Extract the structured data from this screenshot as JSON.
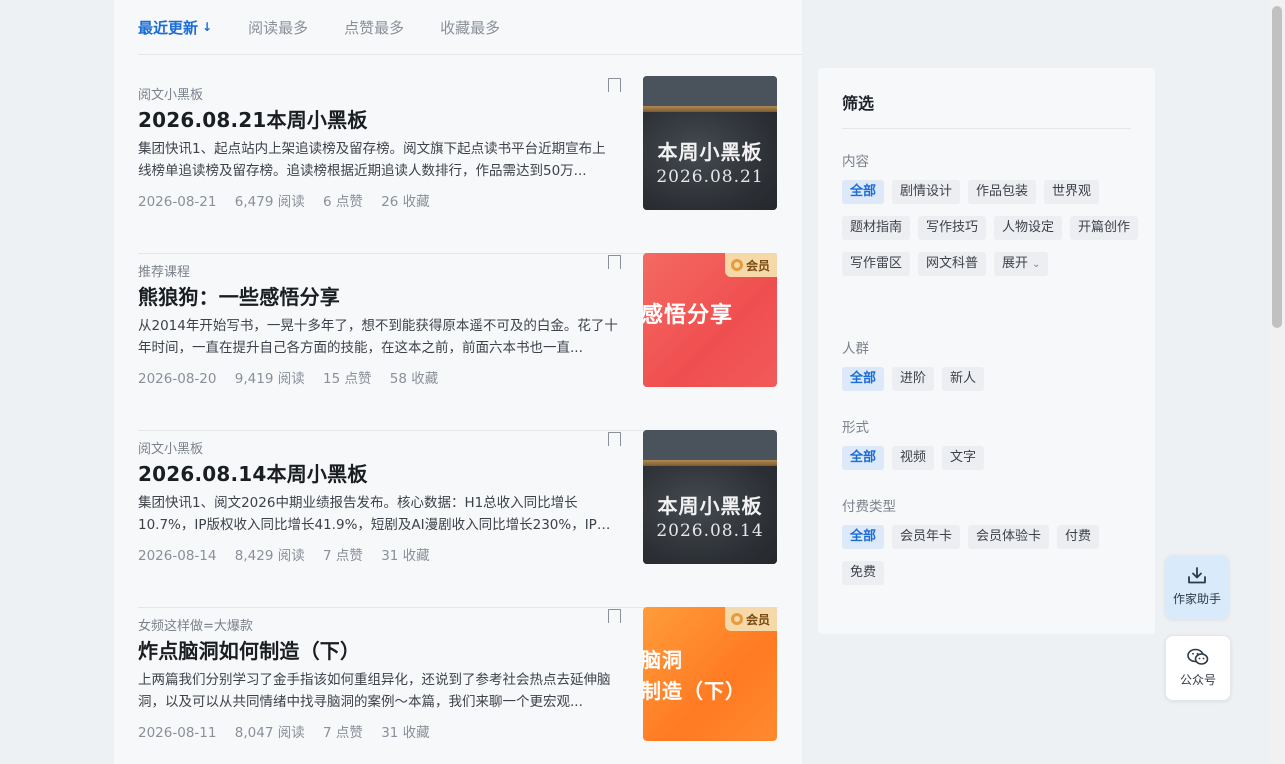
{
  "sort_tabs": [
    {
      "label": "最近更新",
      "active": true
    },
    {
      "label": "阅读最多",
      "active": false
    },
    {
      "label": "点赞最多",
      "active": false
    },
    {
      "label": "收藏最多",
      "active": false
    }
  ],
  "sort_arrow": "↓",
  "articles": [
    {
      "category": "阅文小黑板",
      "title": "2026.08.21本周小黑板",
      "excerpt": "集团快讯1、起点站内上架追读榜及留存榜。阅文旗下起点读书平台近期宣布上线榜单追读榜及留存榜。追读榜根据近期追读人数排行，作品需达到50万...",
      "date": "2026-08-21",
      "reads": "6,479 阅读",
      "likes": "6 点赞",
      "favs": "26 收藏",
      "thumb_main": "本周小黑板",
      "thumb_sub": "2026.08.21"
    },
    {
      "category": "推荐课程",
      "title": "熊狼狗：一些感悟分享",
      "excerpt": "从2014年开始写书，一晃十多年了，想不到能获得原本遥不可及的白金。花了十年时间，一直在提升自己各方面的技能，在这本之前，前面六本书也一直...",
      "date": "2026-08-20",
      "reads": "9,419 阅读",
      "likes": "15 点赞",
      "favs": "58 收藏",
      "thumb_text": "感悟分享",
      "badge": "会员"
    },
    {
      "category": "阅文小黑板",
      "title": "2026.08.14本周小黑板",
      "excerpt": "集团快讯1、阅文2026中期业绩报告发布。核心数据：H1总收入同比增长10.7%，IP版权收入同比增长41.9%，短剧及AI漫剧收入同比增长230%，IP衍...",
      "date": "2026-08-14",
      "reads": "8,429 阅读",
      "likes": "7 点赞",
      "favs": "31 收藏",
      "thumb_main": "本周小黑板",
      "thumb_sub": "2026.08.14"
    },
    {
      "category": "女频这样做=大爆款",
      "title": "炸点脑洞如何制造（下）",
      "excerpt": "上两篇我们分别学习了金手指该如何重组异化，还说到了参考社会热点去延伸脑洞，以及可以从共同情绪中找寻脑洞的案例～本篇，我们来聊一个更宏观...",
      "date": "2026-08-11",
      "reads": "8,047 阅读",
      "likes": "7 点赞",
      "favs": "31 收藏",
      "thumb_text": "脑洞\n制造（下）",
      "badge": "会员"
    }
  ],
  "filter": {
    "title": "筛选",
    "groups": [
      {
        "label": "内容",
        "chips": [
          "全部",
          "剧情设计",
          "作品包装",
          "世界观",
          "题材指南",
          "写作技巧",
          "人物设定",
          "开篇创作",
          "写作雷区",
          "网文科普",
          "展开"
        ]
      },
      {
        "label": "人群",
        "chips": [
          "全部",
          "进阶",
          "新人"
        ]
      },
      {
        "label": "形式",
        "chips": [
          "全部",
          "视频",
          "文字"
        ]
      },
      {
        "label": "付费类型",
        "chips": [
          "全部",
          "会员年卡",
          "会员体验卡",
          "付费",
          "免费"
        ]
      }
    ]
  },
  "float_buttons": {
    "assistant_label": "作家助手",
    "wechat_label": "公众号"
  },
  "colors": {
    "accent": "#1b6dd6",
    "chip_active_bg": "#dde8f8",
    "vip_badge_bg": "#f5d9a8",
    "assistant_bg": "#d9ebfb"
  }
}
